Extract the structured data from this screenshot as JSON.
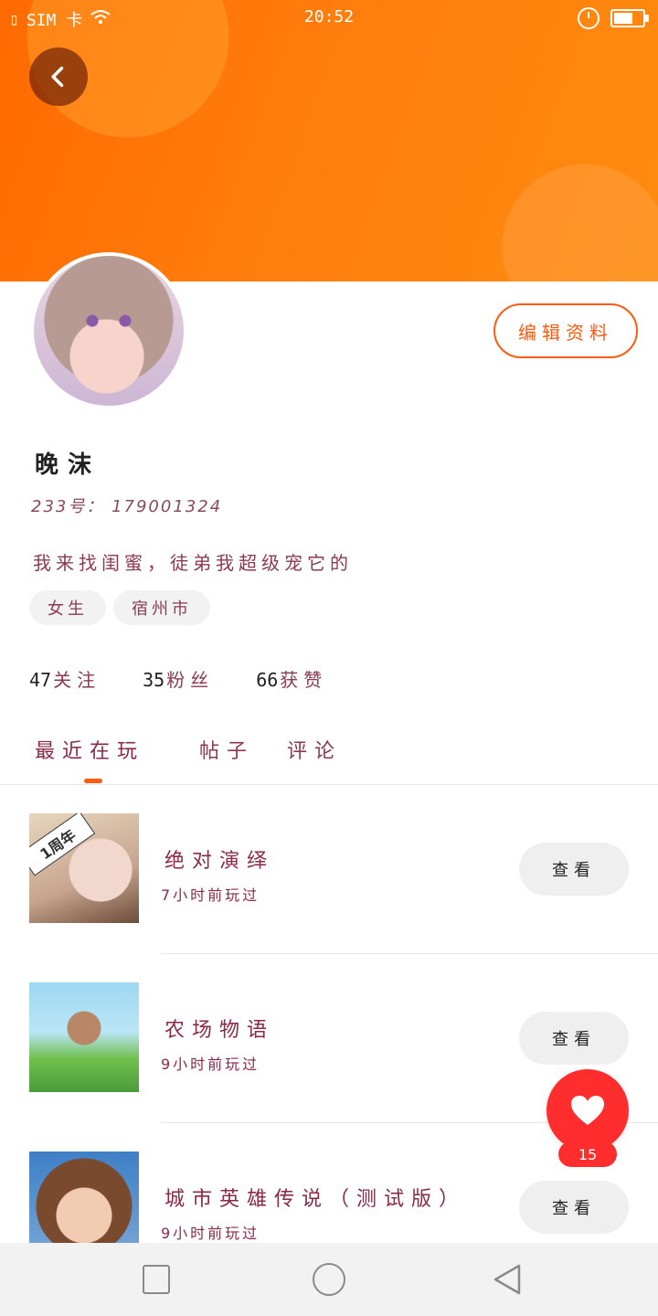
{
  "status_bar": {
    "sim": "SIM 卡",
    "time": "20:52"
  },
  "profile": {
    "edit_label": "编辑资料",
    "username": "晚沫",
    "id_text": "233号： 179001324",
    "bio": "我来找闺蜜，徒弟我超级宠它的",
    "tags": [
      "女生",
      "宿州市"
    ],
    "stats": [
      {
        "num": "47",
        "label": "关注"
      },
      {
        "num": "35",
        "label": "粉丝"
      },
      {
        "num": "66",
        "label": "获赞"
      }
    ]
  },
  "tabs": [
    "最近在玩",
    "帖子",
    "评论"
  ],
  "badge_text": "1周年",
  "games": [
    {
      "title": "绝对演绎",
      "time": "7小时前玩过",
      "button": "查看"
    },
    {
      "title": "农场物语",
      "time": "9小时前玩过",
      "button": "查看"
    },
    {
      "title": "城市英雄传说（测试版）",
      "time": "9小时前玩过",
      "button": "查看"
    }
  ],
  "fab": {
    "count": "15"
  },
  "colors": {
    "accent": "#ff5a10",
    "header": "#ff7a0a",
    "fab": "#ff2d2d"
  },
  "icons": [
    "sim-icon",
    "wifi-icon",
    "alarm-icon",
    "battery-icon",
    "back-icon",
    "heart-icon",
    "nav-square-icon",
    "nav-home-icon",
    "nav-back-icon"
  ]
}
